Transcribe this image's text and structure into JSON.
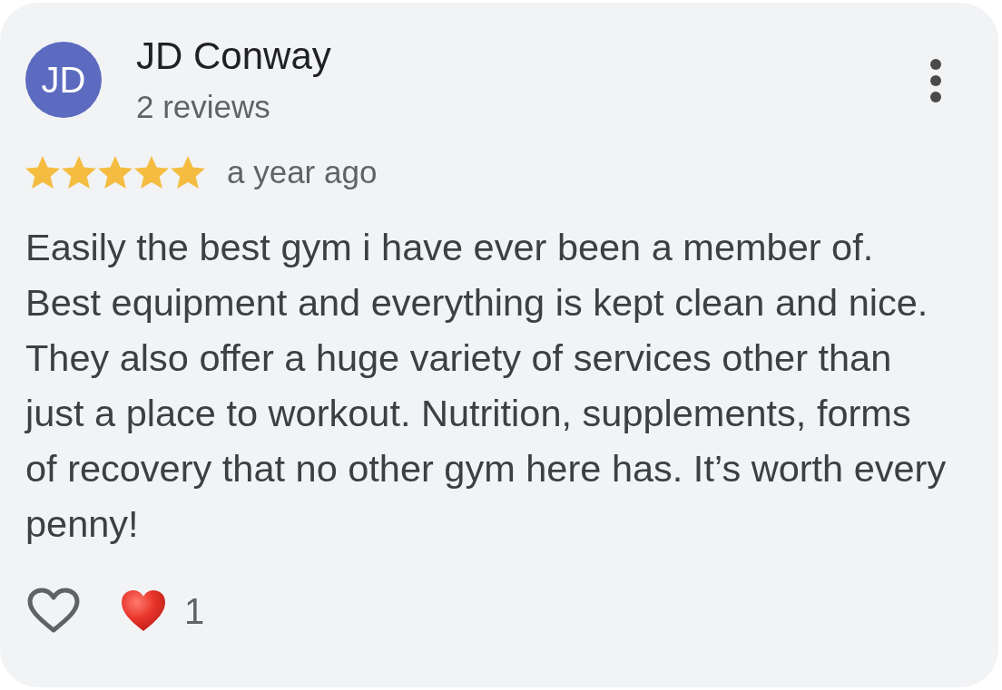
{
  "reviewer": {
    "initials": "JD",
    "name": "JD Conway",
    "review_count": "2 reviews"
  },
  "rating": {
    "stars": 5,
    "time": "a year ago"
  },
  "review_lines": [
    "Easily the best gym i have ever been a member of.",
    "Best equipment and everything is kept clean and nice.",
    "They also offer a huge variety of services other than",
    "just a place to workout. Nutrition, supplements, forms",
    "of recovery that no other gym here has. It’s worth every",
    "penny!"
  ],
  "reactions": {
    "liked": false,
    "count": "1"
  }
}
